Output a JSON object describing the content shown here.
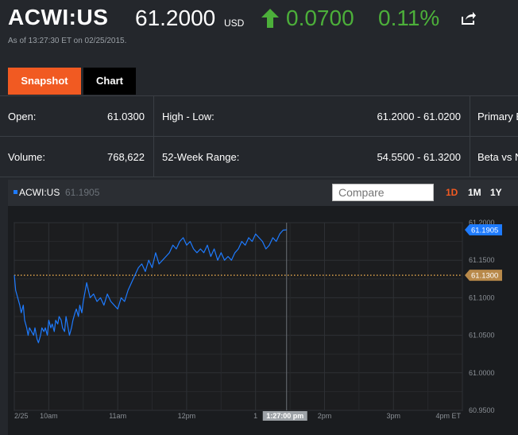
{
  "quote": {
    "ticker": "ACWI:US",
    "price": "61.2000",
    "currency": "USD",
    "change": "0.0700",
    "change_pct": "0.11%",
    "as_of": "As of 13:27:30 ET on 02/25/2015.",
    "colors": {
      "positive": "#4caf3a",
      "accent": "#f15a22"
    }
  },
  "tabs": [
    {
      "label": "Snapshot",
      "active": true
    },
    {
      "label": "Chart",
      "active": false
    }
  ],
  "stats": {
    "rows": [
      {
        "cells": [
          {
            "label": "Open:",
            "value": "61.0300"
          },
          {
            "label": "High - Low:",
            "value": "61.2000 - 61.0200"
          },
          {
            "label": "Primary E"
          }
        ]
      },
      {
        "cells": [
          {
            "label": "Volume:",
            "value": "768,622"
          },
          {
            "label": "52-Week Range:",
            "value": "54.5500 - 61.3200"
          },
          {
            "label": "Beta vs N"
          }
        ]
      }
    ]
  },
  "chart_toolbar": {
    "legend_name": "ACWI:US",
    "legend_value": "61.1905",
    "compare_placeholder": "Compare",
    "ranges": [
      {
        "label": "1D",
        "selected": true
      },
      {
        "label": "1M",
        "selected": false
      },
      {
        "label": "1Y",
        "selected": false
      }
    ]
  },
  "chart_data": {
    "type": "line",
    "x_ticks": [
      "2/25",
      "10am",
      "11am",
      "12pm",
      "1",
      "2pm",
      "3pm",
      "4pm ET"
    ],
    "y_ticks": [
      "61.2000",
      "61.1500",
      "61.1000",
      "61.0500",
      "61.0000",
      "60.9500"
    ],
    "ylim": [
      60.95,
      61.2
    ],
    "session_hours": [
      9.5,
      16
    ],
    "cursor_label": "1:27:00 pm",
    "cursor_time": 13.45,
    "last_value_label": "61.1905",
    "reference_label": "61.1300",
    "reference_value": 61.13,
    "grid": true,
    "series": [
      {
        "color": "#1e7bff",
        "x": [
          9.5,
          9.52,
          9.55,
          9.58,
          9.6,
          9.63,
          9.65,
          9.68,
          9.7,
          9.72,
          9.75,
          9.78,
          9.8,
          9.83,
          9.85,
          9.88,
          9.9,
          9.93,
          9.95,
          9.98,
          10,
          10.03,
          10.05,
          10.08,
          10.1,
          10.13,
          10.15,
          10.18,
          10.2,
          10.23,
          10.25,
          10.28,
          10.3,
          10.33,
          10.35,
          10.38,
          10.4,
          10.43,
          10.45,
          10.48,
          10.5,
          10.55,
          10.6,
          10.65,
          10.7,
          10.75,
          10.8,
          10.85,
          10.9,
          10.95,
          11,
          11.05,
          11.1,
          11.15,
          11.2,
          11.25,
          11.3,
          11.35,
          11.4,
          11.45,
          11.5,
          11.55,
          11.6,
          11.65,
          11.7,
          11.75,
          11.8,
          11.85,
          11.9,
          11.95,
          12,
          12.05,
          12.1,
          12.15,
          12.2,
          12.25,
          12.3,
          12.35,
          12.4,
          12.45,
          12.5,
          12.55,
          12.6,
          12.65,
          12.7,
          12.75,
          12.8,
          12.85,
          12.9,
          12.95,
          13,
          13.05,
          13.1,
          13.15,
          13.2,
          13.25,
          13.3,
          13.35,
          13.4,
          13.45
        ],
        "y": [
          61.13,
          61.11,
          61.1,
          61.09,
          61.08,
          61.09,
          61.07,
          61.06,
          61.05,
          61.06,
          61.055,
          61.05,
          61.06,
          61.045,
          61.04,
          61.05,
          61.06,
          61.055,
          61.06,
          61.05,
          61.07,
          61.06,
          61.065,
          61.055,
          61.07,
          61.065,
          61.075,
          61.07,
          61.06,
          61.055,
          61.075,
          61.06,
          61.05,
          61.06,
          61.07,
          61.08,
          61.085,
          61.075,
          61.09,
          61.08,
          61.095,
          61.12,
          61.1,
          61.105,
          61.095,
          61.1,
          61.09,
          61.105,
          61.095,
          61.09,
          61.085,
          61.1,
          61.095,
          61.11,
          61.12,
          61.13,
          61.14,
          61.145,
          61.135,
          61.15,
          61.14,
          61.16,
          61.145,
          61.15,
          61.155,
          61.16,
          61.17,
          61.165,
          61.175,
          61.18,
          61.17,
          61.175,
          61.165,
          61.16,
          61.165,
          61.16,
          61.17,
          61.155,
          61.165,
          61.15,
          61.16,
          61.15,
          61.155,
          61.15,
          61.16,
          61.165,
          61.175,
          61.17,
          61.18,
          61.175,
          61.185,
          61.18,
          61.175,
          61.165,
          61.17,
          61.18,
          61.175,
          61.185,
          61.19,
          61.1905
        ]
      }
    ]
  }
}
